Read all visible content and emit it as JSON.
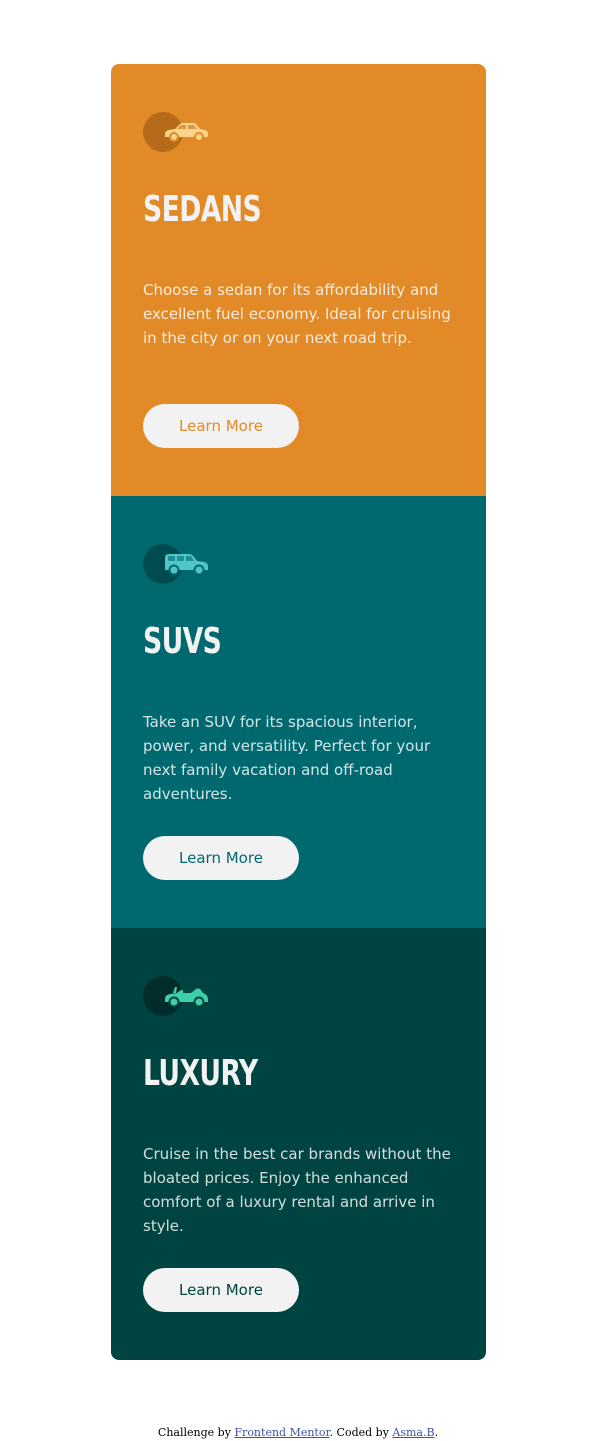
{
  "colors": {
    "sedans_bg": "#e28a27",
    "suvs_bg": "#006970",
    "luxury_bg": "#004441",
    "button_bg": "#f2f2f2",
    "page_bg": "#ffffff",
    "link": "#3e52a3"
  },
  "cards": [
    {
      "icon": "sedan-icon",
      "title": "SEDANS",
      "description": "Choose a sedan for its affordability and excellent fuel economy. Ideal for cruising in the city or on your next road trip.",
      "button_label": "Learn More"
    },
    {
      "icon": "suv-icon",
      "title": "SUVS",
      "description": "Take an SUV for its spacious interior, power, and versatility. Perfect for your next family vacation and off-road adventures.",
      "button_label": "Learn More"
    },
    {
      "icon": "luxury-car-icon",
      "title": "LUXURY",
      "description": "Cruise in the best car brands without the bloated prices. Enjoy the enhanced comfort of a luxury rental and arrive in style.",
      "button_label": "Learn More"
    }
  ],
  "attribution": {
    "prefix": "Challenge by ",
    "challenge_link": "Frontend Mentor",
    "middle": ". Coded by ",
    "author_link": "Asma.B",
    "suffix": "."
  }
}
